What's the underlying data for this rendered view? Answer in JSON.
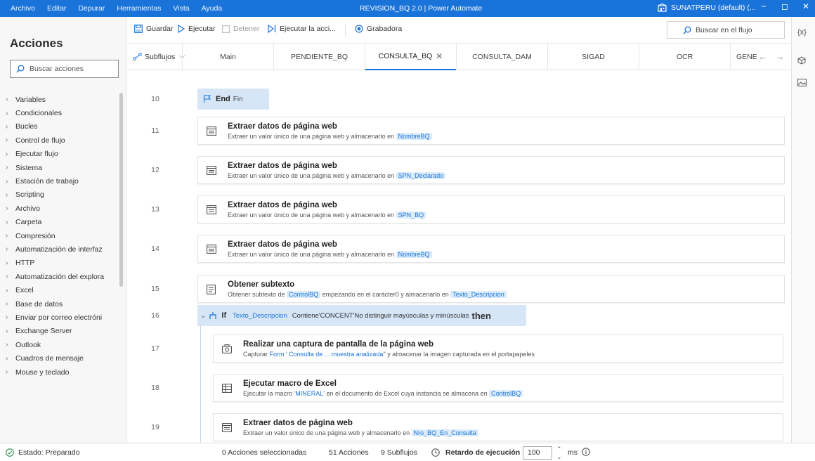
{
  "menu": [
    "Archivo",
    "Editar",
    "Depurar",
    "Herramientas",
    "Vista",
    "Ayuda"
  ],
  "window_title": "REVISION_BQ 2.0 | Power Automate",
  "account": "SUNATPERU (default) (...",
  "window_controls": {
    "minimize": "−",
    "restore": "◻",
    "close": "✕"
  },
  "left_panel": {
    "title": "Acciones",
    "search_placeholder": "Buscar acciones",
    "categories": [
      "Variables",
      "Condicionales",
      "Bucles",
      "Control de flujo",
      "Ejecutar flujo",
      "Sistema",
      "Estación de trabajo",
      "Scripting",
      "Archivo",
      "Carpeta",
      "Compresión",
      "Automatización de interfaz",
      "HTTP",
      "Automatización del explora",
      "Excel",
      "Base de datos",
      "Enviar por correo electróni",
      "Exchange Server",
      "Outlook",
      "Cuadros de mensaje",
      "Mouse y teclado"
    ]
  },
  "toolbar": {
    "save": "Guardar",
    "run": "Ejecutar",
    "stop": "Detener",
    "run_action": "Ejecutar la acci...",
    "recorder": "Grabadora",
    "flow_search": "Buscar en el flujo"
  },
  "tabs": {
    "subflows": "Subflujos",
    "items": [
      "Main",
      "PENDIENTE_BQ",
      "CONSULTA_BQ",
      "CONSULTA_DAM",
      "SIGAD",
      "OCR",
      "GENE"
    ],
    "active_index": 2
  },
  "rail": {
    "variables": "{x}"
  },
  "steps": {
    "end": {
      "line": "10",
      "keyword": "End",
      "label": "Fin"
    },
    "s11": {
      "line": "11",
      "title": "Extraer datos de página web",
      "desc": "Extraer un valor único de una página web y almacenarlo en",
      "var": "NombreBQ"
    },
    "s12": {
      "line": "12",
      "title": "Extraer datos de página web",
      "desc": "Extraer un valor único de una página web y almacenarlo en",
      "var": "SPN_Declarado"
    },
    "s13": {
      "line": "13",
      "title": "Extraer datos de página web",
      "desc": "Extraer un valor único de una página web y almacenarlo en",
      "var": "SPN_BQ"
    },
    "s14": {
      "line": "14",
      "title": "Extraer datos de página web",
      "desc": "Extraer un valor único de una página web y almacenarlo en",
      "var": "NombreBQ"
    },
    "s15": {
      "line": "15",
      "title": "Obtener subtexto",
      "desc_a": "Obtener subtexto de",
      "var_a": "ControlBQ",
      "desc_b": "empezando en el carácter0 y almacenarlo en",
      "var_b": "Texto_Descripcion"
    },
    "s16": {
      "line": "16",
      "keyword": "If",
      "var": "Texto_Descripcion",
      "condition": "Contiene'CONCENT'No distinguir mayúsculas y minúsculas",
      "then": "then"
    },
    "s17": {
      "line": "17",
      "title": "Realizar una captura de pantalla de la página web",
      "desc_a": "Capturar",
      "var": "Form ' Consulta de ... muestra analizada'",
      "desc_b": "' y almacenar la imagen capturada en el portapapeles"
    },
    "s18": {
      "line": "18",
      "title": "Ejecutar macro de Excel",
      "desc_a": "Ejecutar la macro",
      "macro": "'MINERAL'",
      "desc_b": "en el documento de Excel cuya instancia se almacena en",
      "var": "ControlBQ"
    },
    "s19": {
      "line": "19",
      "title": "Extraer datos de página web",
      "desc": "Extraer un valor único de una página web y almacenarlo en",
      "var": "Nro_BQ_En_Consulta"
    }
  },
  "status": {
    "state": "Estado: Preparado",
    "selected": "0 Acciones seleccionadas",
    "actions": "51 Acciones",
    "subflows": "9 Subflujos",
    "delay_label": "Retardo de ejecución",
    "delay_value": "100",
    "unit": "ms"
  },
  "colors": {
    "accent": "#1a73d9",
    "highlight": "#d6e6f7"
  }
}
